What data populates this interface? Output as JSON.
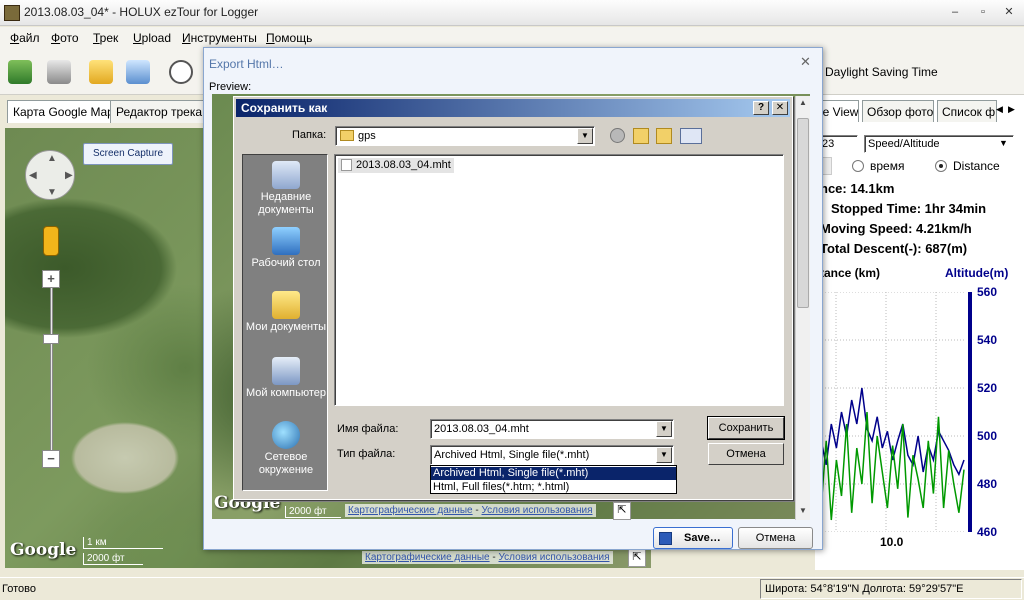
{
  "window": {
    "title": "2013.08.03_04* - HOLUX ezTour for Logger",
    "minimize": "–",
    "maximize": "▫",
    "close": "✕"
  },
  "menu": [
    "Файл",
    "Фото",
    "Трек",
    "Upload",
    "Инструменты",
    "Помощь"
  ],
  "toolbar": {
    "icons": [
      "download-icon",
      "settings-joystick-icon",
      "folder-open-icon",
      "photos-icon",
      "clock-icon"
    ],
    "dst_label": "Daylight Saving Time"
  },
  "left_tabs": [
    "Карта Google Map",
    "Редактор трека"
  ],
  "map": {
    "screen_capture": "Screen Capture",
    "google": "Google",
    "scale_km": "1 км",
    "scale_ft": "2000 фт",
    "credits_data": "Картографические данные",
    "credits_sep": " - ",
    "credits_terms": "Условия использования",
    "zoom_in": "+",
    "zoom_out": "−"
  },
  "preview_map": {
    "google": "Google",
    "scale_ft": "2000 фт",
    "credits_data": "Картографические данные",
    "credits_sep": " - ",
    "credits_terms": "Условия использования"
  },
  "right_panel": {
    "tabs": [
      "le View",
      "Обзор фото",
      "Список ф"
    ],
    "tab_prev": "◀",
    "tab_next": "▶",
    "combo_left": "23",
    "combo_right": "Speed/Altitude",
    "radio_time": "время",
    "radio_distance": "Distance",
    "stats": [
      "nce: 14.1km",
      "Stopped Time: 1hr 34min",
      "Moving Speed: 4.21km/h",
      "Total Descent(-): 687(m)"
    ],
    "x_axis_label": "tance (km)",
    "y_axis_label": "Altitude(m)",
    "x_tick": "10.0"
  },
  "chart_data": {
    "type": "line",
    "title": "",
    "xlabel": "tance (km)",
    "ylabel": "Altitude(m)",
    "x_ticks": [
      "10.0"
    ],
    "y_ticks": [
      560,
      540,
      520,
      500,
      480,
      460
    ],
    "ylim": [
      460,
      560
    ],
    "grid": true,
    "series": [
      {
        "color": "#00008b",
        "values": [
          492,
          498,
          488,
          505,
          495,
          510,
          500,
          515,
          505,
          520,
          503,
          498,
          508,
          495,
          502,
          490,
          498,
          505,
          492,
          488,
          500,
          485,
          496,
          490,
          502,
          498,
          494,
          488,
          484,
          490
        ]
      },
      {
        "color": "#009900",
        "values": [
          480,
          470,
          498,
          465,
          490,
          475,
          505,
          468,
          495,
          480,
          510,
          472,
          500,
          485,
          470,
          496,
          478,
          505,
          466,
          492,
          482,
          470,
          498,
          476,
          508,
          470,
          494,
          480,
          468,
          486
        ]
      }
    ]
  },
  "export_dialog": {
    "title": "Export Html…",
    "preview_label": "Preview:",
    "close": "✕",
    "save_button": "Save…",
    "cancel_button": "Отмена"
  },
  "saveas_dialog": {
    "title": "Сохранить как",
    "help": "?",
    "close": "✕",
    "folder_label": "Папка:",
    "folder_value": "gps",
    "places": [
      "Недавние документы",
      "Рабочий стол",
      "Мои документы",
      "Мой компьютер",
      "Сетевое окружение"
    ],
    "files": [
      "2013.08.03_04.mht"
    ],
    "filename_label": "Имя файла:",
    "filename_value": "2013.08.03_04.mht",
    "filetype_label": "Тип файла:",
    "filetype_value": "Archived Html, Single file(*.mht)",
    "filetype_options": [
      "Archived Html, Single file(*.mht)",
      "Html, Full files(*.htm; *.html)"
    ],
    "save_button": "Сохранить",
    "cancel_button": "Отмена"
  },
  "status": {
    "left": "Готово",
    "coords": "Широта: 54°8'19\"N  Долгота: 59°29'57\"E"
  }
}
